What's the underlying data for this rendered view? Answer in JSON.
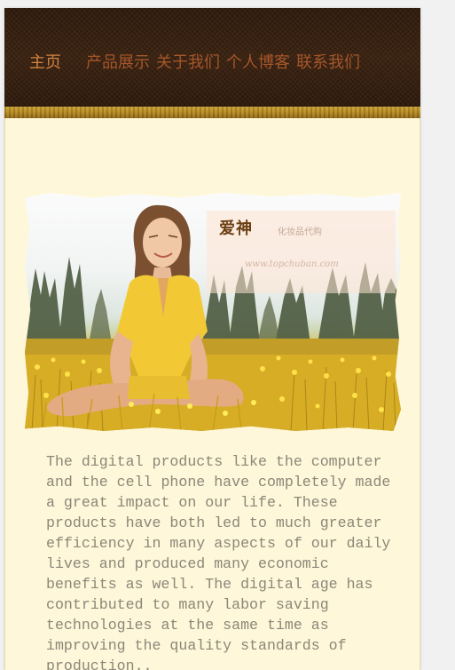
{
  "nav": {
    "items": [
      {
        "label": "主页",
        "active": true
      },
      {
        "label": "产品展示",
        "active": false
      },
      {
        "label": "关于我们",
        "active": false
      },
      {
        "label": "个人博客",
        "active": false
      },
      {
        "label": "联系我们",
        "active": false
      }
    ]
  },
  "banner": {
    "brand": "爱神",
    "subtitle": "化妆品代购",
    "url": "www.topchuban.com"
  },
  "article": {
    "text": "The digital products like the computer and the cell phone have completely made a great impact on our life. These products have both led to much greater efficiency in many aspects of our daily lives and produced many economic benefits as well. The digital age has contributed to many labor saving technologies at the same time as improving the quality standards of production.."
  },
  "colors": {
    "header_bg": "#35200e",
    "gold_strip": "#b98c1f",
    "nav_text": "#a5562a",
    "nav_active": "#d28342",
    "page_bg": "#fff7d9",
    "body_text": "#8b8779"
  }
}
